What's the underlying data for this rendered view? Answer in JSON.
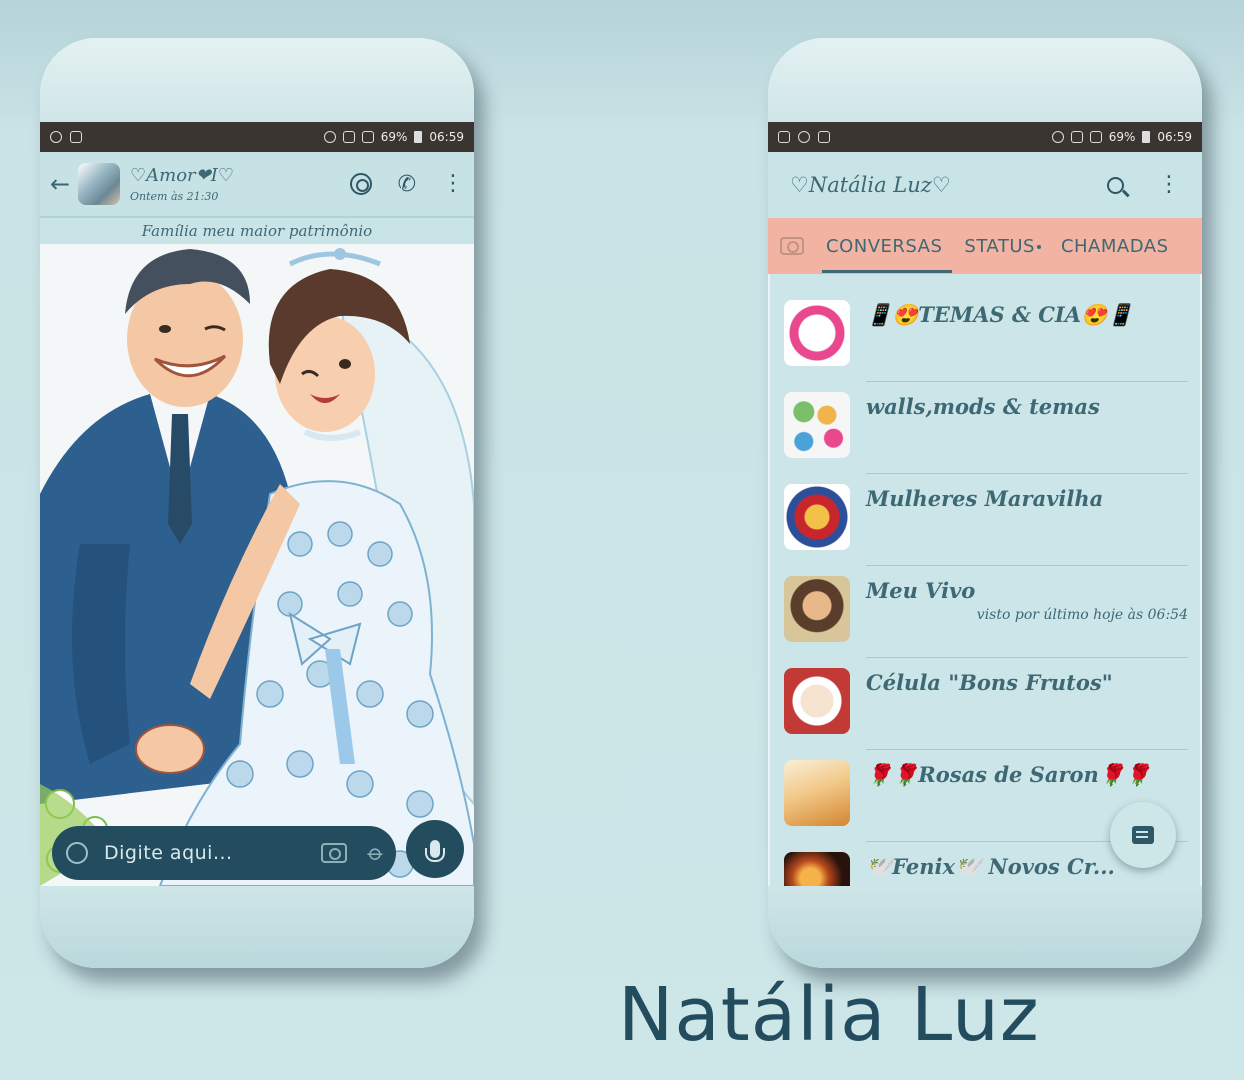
{
  "status_bar": {
    "battery": "69%",
    "time": "06:59"
  },
  "chat": {
    "title": "♡Amor❤I♡",
    "last_seen": "Ontem às 21:30",
    "banner": "Família meu maior patrimônio",
    "input_placeholder": "Digite aqui..."
  },
  "home": {
    "title": "♡Natália Luz♡",
    "tabs": [
      "CONVERSAS",
      "STATUS",
      "CHAMADAS"
    ],
    "conversations": [
      {
        "name": "📱😍TEMAS & CIA😍📱",
        "extra": "",
        "avatar_color": "#e9488f"
      },
      {
        "name": "walls,mods & temas",
        "extra": "",
        "avatar_color": "#7ac06a"
      },
      {
        "name": "Mulheres Maravilha",
        "extra": "",
        "avatar_color": "#c8262c"
      },
      {
        "name": "Meu Vivo",
        "extra": "visto por último hoje às 06:54",
        "avatar_color": "#c59a5e"
      },
      {
        "name": "Célula \"Bons Frutos\"",
        "extra": "",
        "avatar_color": "#c23a35"
      },
      {
        "name": "🌹🌹Rosas de Saron🌹🌹",
        "extra": "",
        "avatar_color": "#e8b36a"
      },
      {
        "name": "🕊️Fenix🕊️ Novos Cr...",
        "extra": "",
        "avatar_color": "#b84a1e"
      }
    ]
  },
  "signature": "Natália Luz"
}
